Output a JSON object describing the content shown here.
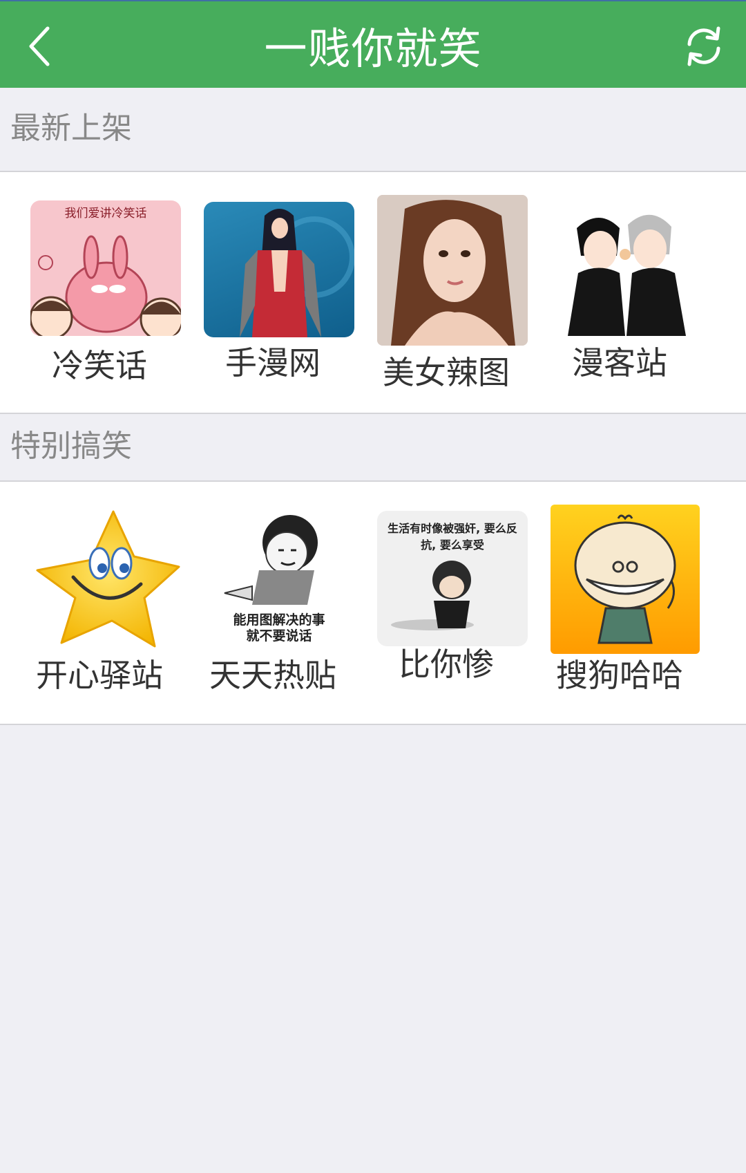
{
  "header": {
    "title": "一贱你就笑",
    "back_icon": "chevron-left-icon",
    "refresh_icon": "refresh-icon",
    "background_color": "#47ad5c"
  },
  "sections": [
    {
      "title": "最新上架",
      "items": [
        {
          "label": "冷笑话",
          "thumbnail_text": "我们爱讲冷笑话"
        },
        {
          "label": "手漫网"
        },
        {
          "label": "美女辣图"
        },
        {
          "label": "漫客站"
        }
      ]
    },
    {
      "title": "特别搞笑",
      "items": [
        {
          "label": "开心驿站"
        },
        {
          "label": "天天热贴",
          "thumbnail_text": "能用图解决的事\n就不要说话"
        },
        {
          "label": "比你惨",
          "thumbnail_text": "生活有时像被强奸, 要么反抗, 要么享受"
        },
        {
          "label": "搜狗哈哈"
        }
      ]
    }
  ]
}
